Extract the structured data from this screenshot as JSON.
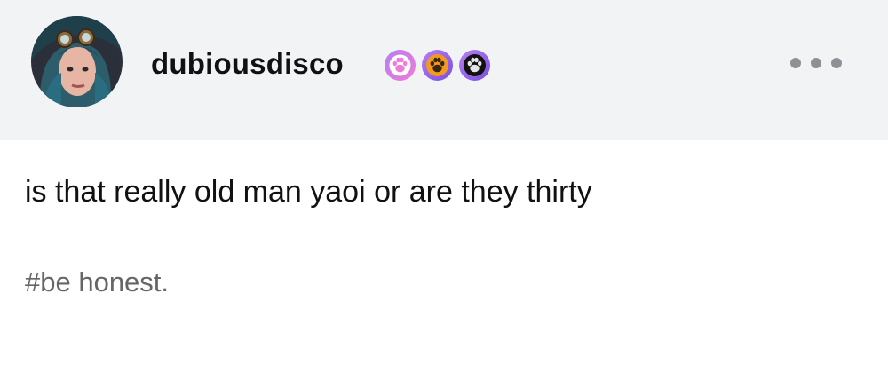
{
  "post": {
    "username": "dubiousdisco",
    "body_text": "is that really old man yaoi or are they thirty",
    "tags": [
      "#be honest."
    ]
  },
  "badges": [
    {
      "icon": "paw-badge-pink-icon",
      "color": "#f07ad8"
    },
    {
      "icon": "paw-badge-orange-icon",
      "color": "#f39a1c"
    },
    {
      "icon": "paw-badge-black-icon",
      "color": "#111111"
    }
  ],
  "colors": {
    "header_bg": "#f1f3f5",
    "text": "#111111",
    "tag_text": "#666666",
    "dots": "#8c9196",
    "top_accent": "#e8524a"
  }
}
